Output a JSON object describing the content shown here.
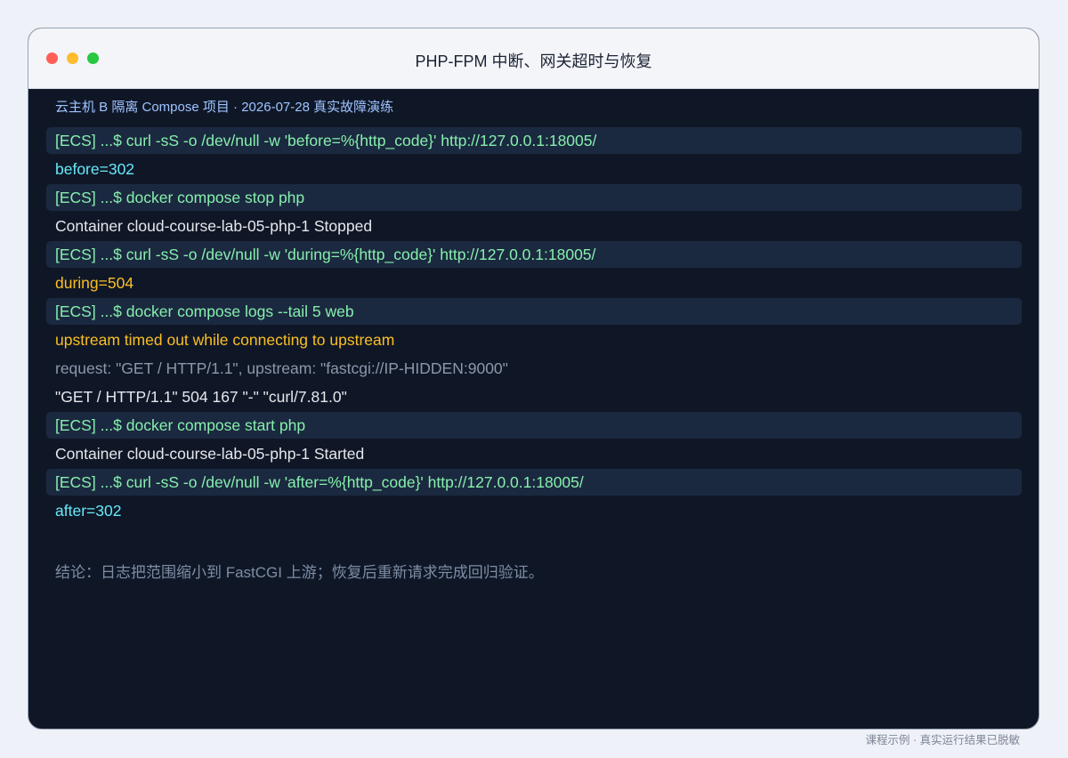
{
  "window": {
    "title": "PHP-FPM 中断、网关超时与恢复",
    "traffic_lights": {
      "close_color": "#ff5f57",
      "minimize_color": "#febc2e",
      "zoom_color": "#28c840"
    }
  },
  "subtitle": "云主机 B 隔离 Compose 项目 · 2026-07-28 真实故障演练",
  "colors": {
    "command": "#86efac",
    "info": "#67e8f9",
    "warning": "#fbbf24",
    "normal": "#e5e7eb",
    "muted": "#8b97aa",
    "command_background": "#1b2940",
    "terminal_background": "#0f1727"
  },
  "log_lines": [
    {
      "type": "command",
      "text": "[ECS] ...$ curl -sS -o /dev/null -w 'before=%{http_code}' http://127.0.0.1:18005/"
    },
    {
      "type": "info",
      "text": "before=302"
    },
    {
      "type": "command",
      "text": "[ECS] ...$ docker compose stop php"
    },
    {
      "type": "normal",
      "text": "Container cloud-course-lab-05-php-1 Stopped"
    },
    {
      "type": "command",
      "text": "[ECS] ...$ curl -sS -o /dev/null -w 'during=%{http_code}' http://127.0.0.1:18005/"
    },
    {
      "type": "warning",
      "text": "during=504"
    },
    {
      "type": "command",
      "text": "[ECS] ...$ docker compose logs --tail 5 web"
    },
    {
      "type": "warning",
      "text": "upstream timed out while connecting to upstream"
    },
    {
      "type": "muted",
      "text": "request: \"GET / HTTP/1.1\", upstream: \"fastcgi://IP-HIDDEN:9000\""
    },
    {
      "type": "normal",
      "text": "\"GET / HTTP/1.1\" 504 167 \"-\" \"curl/7.81.0\""
    },
    {
      "type": "command",
      "text": "[ECS] ...$ docker compose start php"
    },
    {
      "type": "normal",
      "text": "Container cloud-course-lab-05-php-1 Started"
    },
    {
      "type": "command",
      "text": "[ECS] ...$ curl -sS -o /dev/null -w 'after=%{http_code}' http://127.0.0.1:18005/"
    },
    {
      "type": "info",
      "text": "after=302"
    }
  ],
  "conclusion": "结论：日志把范围缩小到 FastCGI 上游；恢复后重新请求完成回归验证。",
  "footnote": "课程示例 · 真实运行结果已脱敏"
}
